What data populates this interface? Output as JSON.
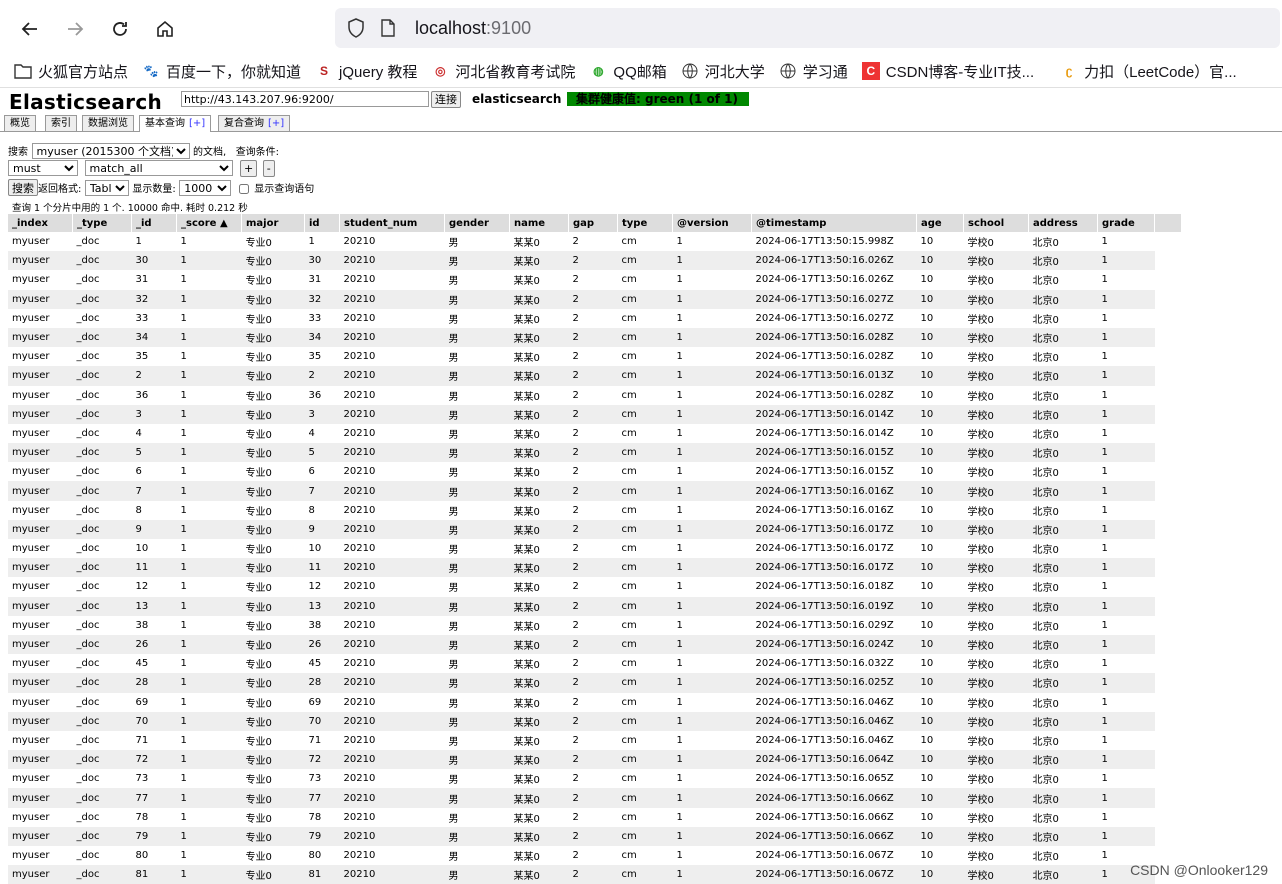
{
  "browser": {
    "url_host": "localhost",
    "url_port": ":9100",
    "bookmarks": [
      {
        "icon": "folder-icon",
        "label": "火狐官方站点"
      },
      {
        "icon": "baidu-paw-icon",
        "label": "百度一下，你就知道"
      },
      {
        "icon": "jquery-icon",
        "label": "jQuery 教程"
      },
      {
        "icon": "hebei-exam-icon",
        "label": "河北省教育考试院"
      },
      {
        "icon": "qq-mail-icon",
        "label": "QQ邮箱"
      },
      {
        "icon": "globe-icon",
        "label": "河北大学"
      },
      {
        "icon": "globe-icon",
        "label": "学习通"
      },
      {
        "icon": "csdn-icon",
        "label": "CSDN博客-专业IT技..."
      },
      {
        "icon": "leetcode-icon",
        "label": "力扣（LeetCode）官..."
      }
    ]
  },
  "es": {
    "logo": "Elasticsearch",
    "url_value": "http://43.143.207.96:9200/",
    "connect_label": "连接",
    "cluster_name": "elasticsearch",
    "health": "集群健康值: green (1 of 1)",
    "tabs": [
      {
        "label": "概览",
        "plus": ""
      },
      {
        "label": "索引",
        "plus": ""
      },
      {
        "label": "数据浏览",
        "plus": ""
      },
      {
        "label": "基本查询",
        "plus": "[+]"
      },
      {
        "label": "复合查询",
        "plus": "[+]"
      }
    ]
  },
  "query": {
    "search_label": "搜索",
    "index_selected": "myuser (2015300 个文档)",
    "docs_label": "的文档,",
    "condition_label": "查询条件:",
    "bool_selected": "must",
    "match_selected": "match_all",
    "add_label": "+",
    "remove_label": "-",
    "search_button": "搜索",
    "format_label": "返回格式:",
    "format_selected": "Table",
    "size_label": "显示数量:",
    "size_selected": "1000",
    "show_query_label": "显示查询语句",
    "result_info": "查询 1 个分片中用的 1 个. 10000 命中. 耗时 0.212 秒"
  },
  "table": {
    "columns": [
      "_index",
      "_type",
      "_id",
      "_score ▲",
      "major",
      "id",
      "student_num",
      "gender",
      "name",
      "gap",
      "type",
      "@version",
      "@timestamp",
      "age",
      "school",
      "address",
      "grade"
    ],
    "rows": [
      [
        "myuser",
        "_doc",
        "1",
        "1",
        "专业0",
        "1",
        "20210",
        "男",
        "某某0",
        "2",
        "cm",
        "1",
        "2024-06-17T13:50:15.998Z",
        "10",
        "学校0",
        "北京0",
        "1"
      ],
      [
        "myuser",
        "_doc",
        "30",
        "1",
        "专业0",
        "30",
        "20210",
        "男",
        "某某0",
        "2",
        "cm",
        "1",
        "2024-06-17T13:50:16.026Z",
        "10",
        "学校0",
        "北京0",
        "1"
      ],
      [
        "myuser",
        "_doc",
        "31",
        "1",
        "专业0",
        "31",
        "20210",
        "男",
        "某某0",
        "2",
        "cm",
        "1",
        "2024-06-17T13:50:16.026Z",
        "10",
        "学校0",
        "北京0",
        "1"
      ],
      [
        "myuser",
        "_doc",
        "32",
        "1",
        "专业0",
        "32",
        "20210",
        "男",
        "某某0",
        "2",
        "cm",
        "1",
        "2024-06-17T13:50:16.027Z",
        "10",
        "学校0",
        "北京0",
        "1"
      ],
      [
        "myuser",
        "_doc",
        "33",
        "1",
        "专业0",
        "33",
        "20210",
        "男",
        "某某0",
        "2",
        "cm",
        "1",
        "2024-06-17T13:50:16.027Z",
        "10",
        "学校0",
        "北京0",
        "1"
      ],
      [
        "myuser",
        "_doc",
        "34",
        "1",
        "专业0",
        "34",
        "20210",
        "男",
        "某某0",
        "2",
        "cm",
        "1",
        "2024-06-17T13:50:16.028Z",
        "10",
        "学校0",
        "北京0",
        "1"
      ],
      [
        "myuser",
        "_doc",
        "35",
        "1",
        "专业0",
        "35",
        "20210",
        "男",
        "某某0",
        "2",
        "cm",
        "1",
        "2024-06-17T13:50:16.028Z",
        "10",
        "学校0",
        "北京0",
        "1"
      ],
      [
        "myuser",
        "_doc",
        "2",
        "1",
        "专业0",
        "2",
        "20210",
        "男",
        "某某0",
        "2",
        "cm",
        "1",
        "2024-06-17T13:50:16.013Z",
        "10",
        "学校0",
        "北京0",
        "1"
      ],
      [
        "myuser",
        "_doc",
        "36",
        "1",
        "专业0",
        "36",
        "20210",
        "男",
        "某某0",
        "2",
        "cm",
        "1",
        "2024-06-17T13:50:16.028Z",
        "10",
        "学校0",
        "北京0",
        "1"
      ],
      [
        "myuser",
        "_doc",
        "3",
        "1",
        "专业0",
        "3",
        "20210",
        "男",
        "某某0",
        "2",
        "cm",
        "1",
        "2024-06-17T13:50:16.014Z",
        "10",
        "学校0",
        "北京0",
        "1"
      ],
      [
        "myuser",
        "_doc",
        "4",
        "1",
        "专业0",
        "4",
        "20210",
        "男",
        "某某0",
        "2",
        "cm",
        "1",
        "2024-06-17T13:50:16.014Z",
        "10",
        "学校0",
        "北京0",
        "1"
      ],
      [
        "myuser",
        "_doc",
        "5",
        "1",
        "专业0",
        "5",
        "20210",
        "男",
        "某某0",
        "2",
        "cm",
        "1",
        "2024-06-17T13:50:16.015Z",
        "10",
        "学校0",
        "北京0",
        "1"
      ],
      [
        "myuser",
        "_doc",
        "6",
        "1",
        "专业0",
        "6",
        "20210",
        "男",
        "某某0",
        "2",
        "cm",
        "1",
        "2024-06-17T13:50:16.015Z",
        "10",
        "学校0",
        "北京0",
        "1"
      ],
      [
        "myuser",
        "_doc",
        "7",
        "1",
        "专业0",
        "7",
        "20210",
        "男",
        "某某0",
        "2",
        "cm",
        "1",
        "2024-06-17T13:50:16.016Z",
        "10",
        "学校0",
        "北京0",
        "1"
      ],
      [
        "myuser",
        "_doc",
        "8",
        "1",
        "专业0",
        "8",
        "20210",
        "男",
        "某某0",
        "2",
        "cm",
        "1",
        "2024-06-17T13:50:16.016Z",
        "10",
        "学校0",
        "北京0",
        "1"
      ],
      [
        "myuser",
        "_doc",
        "9",
        "1",
        "专业0",
        "9",
        "20210",
        "男",
        "某某0",
        "2",
        "cm",
        "1",
        "2024-06-17T13:50:16.017Z",
        "10",
        "学校0",
        "北京0",
        "1"
      ],
      [
        "myuser",
        "_doc",
        "10",
        "1",
        "专业0",
        "10",
        "20210",
        "男",
        "某某0",
        "2",
        "cm",
        "1",
        "2024-06-17T13:50:16.017Z",
        "10",
        "学校0",
        "北京0",
        "1"
      ],
      [
        "myuser",
        "_doc",
        "11",
        "1",
        "专业0",
        "11",
        "20210",
        "男",
        "某某0",
        "2",
        "cm",
        "1",
        "2024-06-17T13:50:16.017Z",
        "10",
        "学校0",
        "北京0",
        "1"
      ],
      [
        "myuser",
        "_doc",
        "12",
        "1",
        "专业0",
        "12",
        "20210",
        "男",
        "某某0",
        "2",
        "cm",
        "1",
        "2024-06-17T13:50:16.018Z",
        "10",
        "学校0",
        "北京0",
        "1"
      ],
      [
        "myuser",
        "_doc",
        "13",
        "1",
        "专业0",
        "13",
        "20210",
        "男",
        "某某0",
        "2",
        "cm",
        "1",
        "2024-06-17T13:50:16.019Z",
        "10",
        "学校0",
        "北京0",
        "1"
      ],
      [
        "myuser",
        "_doc",
        "38",
        "1",
        "专业0",
        "38",
        "20210",
        "男",
        "某某0",
        "2",
        "cm",
        "1",
        "2024-06-17T13:50:16.029Z",
        "10",
        "学校0",
        "北京0",
        "1"
      ],
      [
        "myuser",
        "_doc",
        "26",
        "1",
        "专业0",
        "26",
        "20210",
        "男",
        "某某0",
        "2",
        "cm",
        "1",
        "2024-06-17T13:50:16.024Z",
        "10",
        "学校0",
        "北京0",
        "1"
      ],
      [
        "myuser",
        "_doc",
        "45",
        "1",
        "专业0",
        "45",
        "20210",
        "男",
        "某某0",
        "2",
        "cm",
        "1",
        "2024-06-17T13:50:16.032Z",
        "10",
        "学校0",
        "北京0",
        "1"
      ],
      [
        "myuser",
        "_doc",
        "28",
        "1",
        "专业0",
        "28",
        "20210",
        "男",
        "某某0",
        "2",
        "cm",
        "1",
        "2024-06-17T13:50:16.025Z",
        "10",
        "学校0",
        "北京0",
        "1"
      ],
      [
        "myuser",
        "_doc",
        "69",
        "1",
        "专业0",
        "69",
        "20210",
        "男",
        "某某0",
        "2",
        "cm",
        "1",
        "2024-06-17T13:50:16.046Z",
        "10",
        "学校0",
        "北京0",
        "1"
      ],
      [
        "myuser",
        "_doc",
        "70",
        "1",
        "专业0",
        "70",
        "20210",
        "男",
        "某某0",
        "2",
        "cm",
        "1",
        "2024-06-17T13:50:16.046Z",
        "10",
        "学校0",
        "北京0",
        "1"
      ],
      [
        "myuser",
        "_doc",
        "71",
        "1",
        "专业0",
        "71",
        "20210",
        "男",
        "某某0",
        "2",
        "cm",
        "1",
        "2024-06-17T13:50:16.046Z",
        "10",
        "学校0",
        "北京0",
        "1"
      ],
      [
        "myuser",
        "_doc",
        "72",
        "1",
        "专业0",
        "72",
        "20210",
        "男",
        "某某0",
        "2",
        "cm",
        "1",
        "2024-06-17T13:50:16.064Z",
        "10",
        "学校0",
        "北京0",
        "1"
      ],
      [
        "myuser",
        "_doc",
        "73",
        "1",
        "专业0",
        "73",
        "20210",
        "男",
        "某某0",
        "2",
        "cm",
        "1",
        "2024-06-17T13:50:16.065Z",
        "10",
        "学校0",
        "北京0",
        "1"
      ],
      [
        "myuser",
        "_doc",
        "77",
        "1",
        "专业0",
        "77",
        "20210",
        "男",
        "某某0",
        "2",
        "cm",
        "1",
        "2024-06-17T13:50:16.066Z",
        "10",
        "学校0",
        "北京0",
        "1"
      ],
      [
        "myuser",
        "_doc",
        "78",
        "1",
        "专业0",
        "78",
        "20210",
        "男",
        "某某0",
        "2",
        "cm",
        "1",
        "2024-06-17T13:50:16.066Z",
        "10",
        "学校0",
        "北京0",
        "1"
      ],
      [
        "myuser",
        "_doc",
        "79",
        "1",
        "专业0",
        "79",
        "20210",
        "男",
        "某某0",
        "2",
        "cm",
        "1",
        "2024-06-17T13:50:16.066Z",
        "10",
        "学校0",
        "北京0",
        "1"
      ],
      [
        "myuser",
        "_doc",
        "80",
        "1",
        "专业0",
        "80",
        "20210",
        "男",
        "某某0",
        "2",
        "cm",
        "1",
        "2024-06-17T13:50:16.067Z",
        "10",
        "学校0",
        "北京0",
        "1"
      ],
      [
        "myuser",
        "_doc",
        "81",
        "1",
        "专业0",
        "81",
        "20210",
        "男",
        "某某0",
        "2",
        "cm",
        "1",
        "2024-06-17T13:50:16.067Z",
        "10",
        "学校0",
        "北京0",
        "1"
      ]
    ]
  },
  "watermark": "CSDN @Onlooker129",
  "colors": {
    "health_green": "#008800",
    "tab_plus": "#3333ff",
    "header_gray": "#dddddd",
    "row_alt": "#eeeeee"
  }
}
